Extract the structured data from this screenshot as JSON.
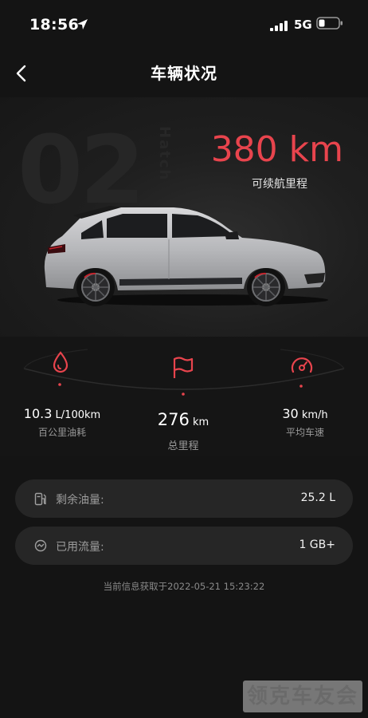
{
  "status_bar": {
    "time": "18:56",
    "network": "5G"
  },
  "nav": {
    "title": "车辆状况"
  },
  "hero": {
    "background_model": "02",
    "background_word": "Hatch",
    "range_value": "380 km",
    "range_label": "可续航里程",
    "range_color": "#e8444d"
  },
  "stats": [
    {
      "icon": "fuel-drop-icon",
      "number": "10.3",
      "unit": " L/100km",
      "label": "百公里油耗"
    },
    {
      "icon": "flag-icon",
      "number": "276",
      "unit": " km",
      "label": "总里程"
    },
    {
      "icon": "speedometer-icon",
      "number": "30",
      "unit": " km/h",
      "label": "平均车速"
    }
  ],
  "cards": [
    {
      "icon": "fuel-pump-icon",
      "label": "剩余油量:",
      "value": "25.2 L"
    },
    {
      "icon": "data-usage-icon",
      "label": "已用流量:",
      "value": "1 GB+"
    }
  ],
  "timestamp": "当前信息获取于2022-05-21 15:23:22",
  "watermark": "领克车友会"
}
